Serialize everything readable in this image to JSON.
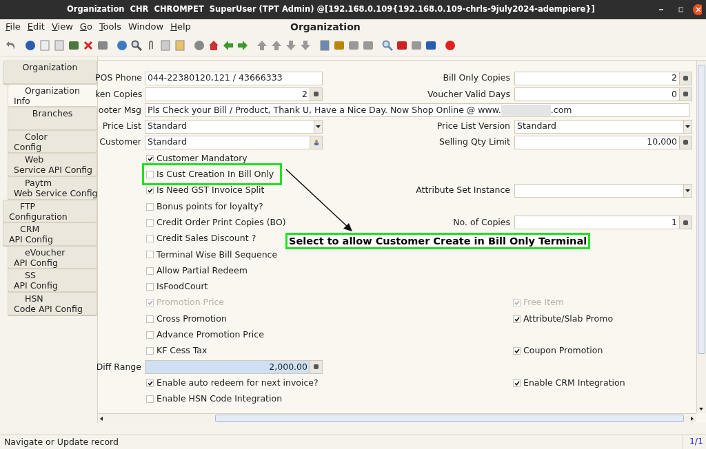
{
  "window": {
    "title": "Organization  CHR  CHROMPET  SuperUser (TPT Admin) @",
    "server": "[192.168.0.109{192.168.0.109-chrls-9july2024-adempiere}]"
  },
  "menu": [
    {
      "label": "File",
      "mnemonic": true
    },
    {
      "label": "Edit",
      "mnemonic": true
    },
    {
      "label": "View",
      "mnemonic": true
    },
    {
      "label": "Go",
      "mnemonic": true
    },
    {
      "label": "Tools",
      "mnemonic": true
    },
    {
      "label": "Window",
      "mnemonic": false
    },
    {
      "label": "Help",
      "mnemonic": true
    }
  ],
  "heading": "Organization",
  "sidebar": {
    "items": [
      {
        "label": "Organization",
        "selected": false,
        "children": [
          {
            "label": "Organization\nInfo",
            "selected": true
          },
          {
            "label": "Branches",
            "selected": false
          },
          {
            "label": "Color\nConfig",
            "selected": false
          },
          {
            "label": "Web\nService API Config",
            "selected": false
          },
          {
            "label": "Paytm\nWeb Service Config",
            "selected": false
          }
        ]
      },
      {
        "label": "FTP\nConfiguration",
        "selected": false
      },
      {
        "label": "CRM\nAPI Config",
        "selected": false,
        "children": [
          {
            "label": "eVoucher\nAPI Config",
            "selected": false
          },
          {
            "label": "SS\nAPI Config",
            "selected": false
          },
          {
            "label": "HSN\nCode API Config",
            "selected": false
          }
        ]
      }
    ]
  },
  "form": {
    "rows": [
      {
        "left": {
          "kind": "text",
          "label": "POS Phone",
          "value": "044-22380120,121 / 43666333"
        },
        "right": {
          "kind": "number",
          "label": "Bill Only Copies",
          "value": "2"
        }
      },
      {
        "left": {
          "kind": "number",
          "label": "ken Copies",
          "value": "2"
        },
        "right": {
          "kind": "number",
          "label": "Voucher Valid Days",
          "value": "0"
        }
      },
      {
        "left": {
          "kind": "wide",
          "label": "ooter Msg",
          "value": "Pls Check your Bill / Product, Thank U, Have a Nice Day. Now Shop Online @ www.",
          "value_after": ".com"
        }
      },
      {
        "left": {
          "kind": "combo",
          "label": "Price List",
          "value": "Standard"
        },
        "right": {
          "kind": "combo",
          "label": "Price List Version",
          "value": "Standard"
        }
      },
      {
        "left": {
          "kind": "lookup",
          "label": "Customer",
          "value": "Standard"
        },
        "right": {
          "kind": "number",
          "label": "Selling Qty Limit",
          "value": "10,000"
        }
      },
      {
        "left": {
          "kind": "checkbox",
          "label": "Customer Mandatory",
          "checked": true,
          "disabled": false
        }
      },
      {
        "left": {
          "kind": "checkbox",
          "label": "Is Cust Creation In Bill Only",
          "checked": false,
          "disabled": false,
          "annotated": true
        }
      },
      {
        "left": {
          "kind": "checkbox",
          "label": "Is Need GST Invoice Split",
          "checked": true,
          "disabled": false
        },
        "right": {
          "kind": "combo",
          "label": "Attribute Set Instance"
        }
      },
      {
        "left": {
          "kind": "checkbox",
          "label": "Bonus points for loyalty?",
          "checked": false,
          "disabled": false
        }
      },
      {
        "left": {
          "kind": "checkbox",
          "label": "Credit Order Print Copies (BO)",
          "checked": false,
          "disabled": false
        },
        "right": {
          "kind": "number",
          "label": "No. of Copies",
          "value": "1"
        }
      },
      {
        "left": {
          "kind": "checkbox",
          "label": "Credit Sales Discount ?",
          "checked": false,
          "disabled": false
        }
      },
      {
        "left": {
          "kind": "checkbox",
          "label": "Terminal Wise Bill Sequence",
          "checked": false,
          "disabled": false
        }
      },
      {
        "left": {
          "kind": "checkbox",
          "label": "Allow Partial Redeem",
          "checked": false,
          "disabled": false
        }
      },
      {
        "left": {
          "kind": "checkbox",
          "label": "IsFoodCourt",
          "checked": false,
          "disabled": false
        }
      },
      {
        "left": {
          "kind": "checkbox",
          "label": "Promotion Price",
          "checked": true,
          "disabled": true
        },
        "right": {
          "kind": "checkbox",
          "label": "Free Item",
          "checked": true,
          "disabled": true
        }
      },
      {
        "left": {
          "kind": "checkbox",
          "label": "Cross Promotion",
          "checked": false,
          "disabled": false
        },
        "right": {
          "kind": "checkbox",
          "label": "Attribute/Slab Promo",
          "checked": true,
          "disabled": false
        }
      },
      {
        "left": {
          "kind": "checkbox",
          "label": "Advance Promotion Price",
          "checked": false,
          "disabled": false
        }
      },
      {
        "left": {
          "kind": "checkbox",
          "label": "KF Cess Tax",
          "checked": false,
          "disabled": false
        },
        "right": {
          "kind": "checkbox",
          "label": "Coupon Promotion",
          "checked": true,
          "disabled": false
        }
      },
      {
        "left": {
          "kind": "number",
          "label": "Diff Range",
          "value": "2,000.00",
          "highlighted": true
        }
      },
      {
        "left": {
          "kind": "checkbox",
          "label": "Enable auto redeem for next invoice?",
          "checked": true,
          "disabled": false
        },
        "right": {
          "kind": "checkbox",
          "label": "Enable CRM Integration",
          "checked": true,
          "disabled": false
        }
      },
      {
        "left": {
          "kind": "checkbox",
          "label": "Enable HSN Code Integration",
          "checked": false,
          "disabled": false
        }
      }
    ]
  },
  "annotation": {
    "text": "Select to allow Customer Create in Bill Only Terminal"
  },
  "status_bar": {
    "message": "Navigate or Update record",
    "record": "1/1"
  }
}
